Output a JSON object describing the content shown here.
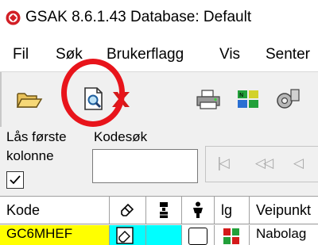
{
  "window": {
    "title": "GSAK 8.6.1.43   Database: Default",
    "icon": "gsak-logo-icon"
  },
  "menu": {
    "items": [
      "Fil",
      "Søk",
      "Brukerflagg",
      "Vis",
      "Senter"
    ]
  },
  "toolbar": {
    "buttons": [
      {
        "name": "open-database-button",
        "icon": "folder-open-icon"
      },
      {
        "name": "preview-button",
        "icon": "print-preview-icon",
        "highlighted": true
      },
      {
        "name": "delete-button",
        "icon": "red-x-icon"
      },
      {
        "name": "print-button",
        "icon": "printer-icon"
      },
      {
        "name": "grid-view-button",
        "icon": "colored-grid-icon"
      },
      {
        "name": "tools-button",
        "icon": "gears-icon"
      }
    ],
    "highlight_color": "#e8141b"
  },
  "filters": {
    "lock_first_column_label_line1": "Lås første",
    "lock_first_column_label_line2": "kolonne",
    "lock_first_column_checked": true,
    "code_search_label": "Kodesøk",
    "code_search_value": "",
    "nav_buttons": [
      "first-record",
      "previous-page",
      "previous-record"
    ]
  },
  "grid": {
    "columns": [
      {
        "label": "Kode",
        "icon": null
      },
      {
        "label": "",
        "icon": "eraser-icon"
      },
      {
        "label": "",
        "icon": "traveler-icon"
      },
      {
        "label": "",
        "icon": "person-icon"
      },
      {
        "label": "lg",
        "icon": null
      },
      {
        "label": "Veipunkt",
        "icon": null
      }
    ],
    "rows": [
      {
        "code": "GC6MHEF",
        "waypoint": "Nabolag",
        "code_bg": "#ffff00",
        "flag_bg": "#00ffff"
      }
    ]
  }
}
